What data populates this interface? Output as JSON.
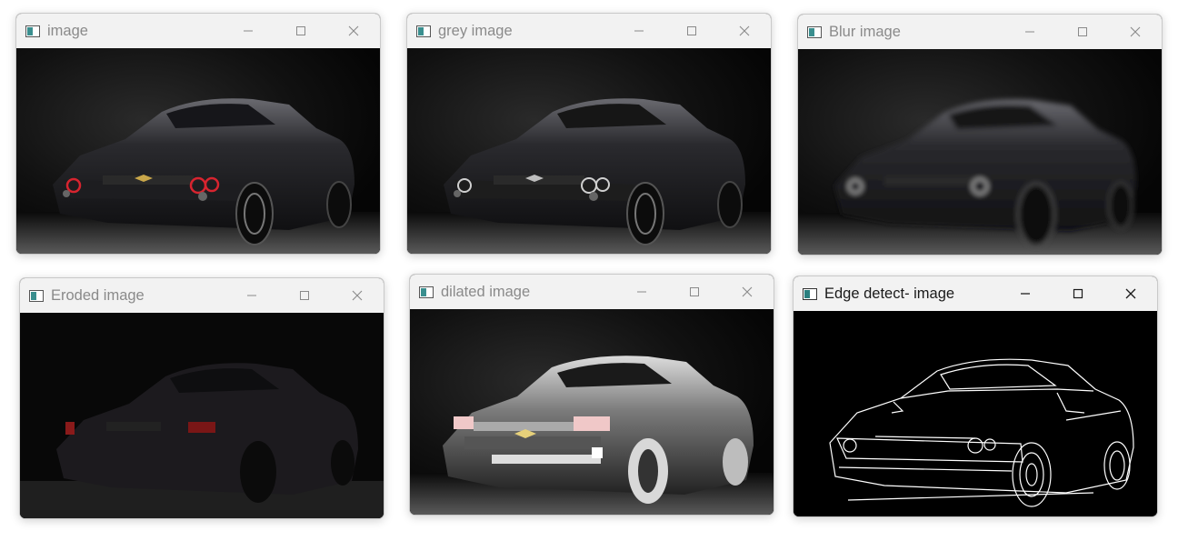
{
  "windows": [
    {
      "title": "image"
    },
    {
      "title": "grey image"
    },
    {
      "title": "Blur image"
    },
    {
      "title": "Eroded image"
    },
    {
      "title": "dilated image"
    },
    {
      "title": "Edge detect- image"
    }
  ],
  "controls": {
    "minimize": "minimize-icon",
    "maximize": "maximize-icon",
    "close": "close-icon"
  },
  "colors": {
    "titlebar": "#f2f2f2",
    "inactive_title": "#8a8a8a",
    "active_title": "#1a1a1a",
    "image_bg": "#050505",
    "edge_lines": "#ffffff",
    "headlight_red": "#d8242f"
  }
}
